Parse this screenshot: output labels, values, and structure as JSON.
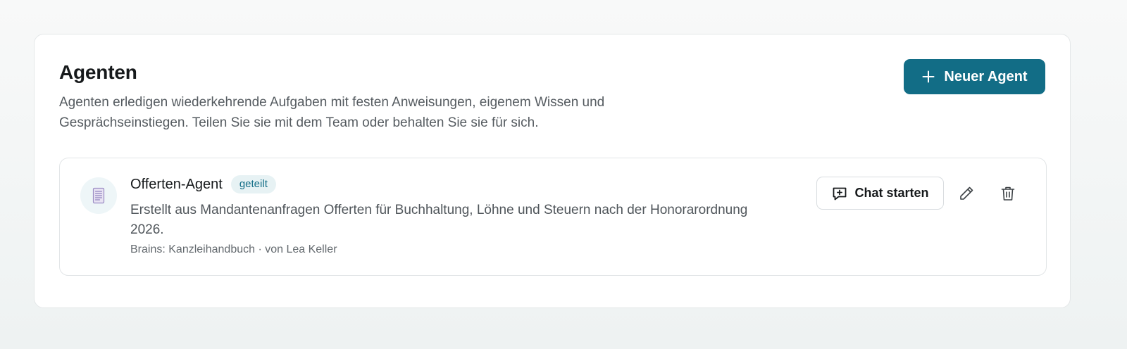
{
  "header": {
    "title": "Agenten",
    "description": "Agenten erledigen wiederkehrende Aufgaben mit festen Anweisungen, eigenem Wissen und Gesprächseinstiegen. Teilen Sie sie mit dem Team oder behalten Sie sie für sich.",
    "new_agent_label": "Neuer Agent",
    "new_agent_icon": "plus-icon"
  },
  "agents": [
    {
      "name": "Offerten-Agent",
      "badge": "geteilt",
      "description": "Erstellt aus Mandantenanfragen Offerten für Buchhaltung, Löhne und Steuern nach der Honorarordnung 2026.",
      "meta": "Brains: Kanzleihandbuch · von Lea Keller",
      "avatar_icon": "document-icon",
      "actions": {
        "chat_label": "Chat starten",
        "chat_icon": "chat-plus-icon",
        "edit_icon": "pencil-icon",
        "delete_icon": "trash-icon"
      }
    }
  ],
  "colors": {
    "accent": "#126d86",
    "badge_bg": "#e7f2f4",
    "page_bg": "#f3f6f6"
  }
}
